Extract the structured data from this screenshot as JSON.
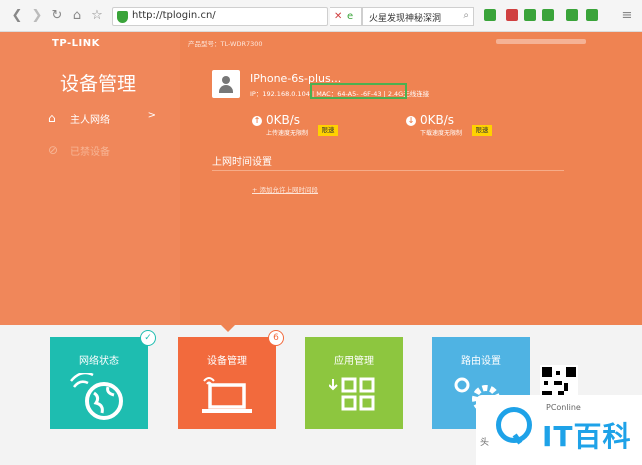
{
  "browser": {
    "url": "http://tplogin.cn/",
    "search_text": "火星发现神秘深洞"
  },
  "app": {
    "logo": "TP-LINK",
    "model": "产品型号：TL-WDR7300",
    "page_title": "设备管理",
    "nav": [
      {
        "label": "主人网络",
        "arrow": ">"
      },
      {
        "label": "已禁设备"
      }
    ],
    "device": {
      "name": "IPhone-6s-plus...",
      "info": "IP：192.168.0.104 | MAC：64-A5-         -6F-43 | 2.4G无线连接"
    },
    "upload": {
      "value": "0KB/s",
      "caption": "上传速度无限制",
      "limit_button": "限速"
    },
    "download": {
      "value": "0KB/s",
      "caption": "下载速度无限制",
      "limit_button": "限速"
    },
    "schedule": {
      "title": "上网时间设置",
      "add_link": "+ 添加允许上网时间段"
    }
  },
  "tiles": [
    {
      "label": "网络状态",
      "badge": "✓",
      "color": "#1ebdb0"
    },
    {
      "label": "设备管理",
      "badge": "6",
      "color": "#f26a3d"
    },
    {
      "label": "应用管理",
      "color": "#8dc63f"
    },
    {
      "label": "路由设置",
      "color": "#4fb3e3"
    }
  ],
  "watermark": {
    "small": "PConline",
    "big": "IT百科",
    "side": "头"
  }
}
